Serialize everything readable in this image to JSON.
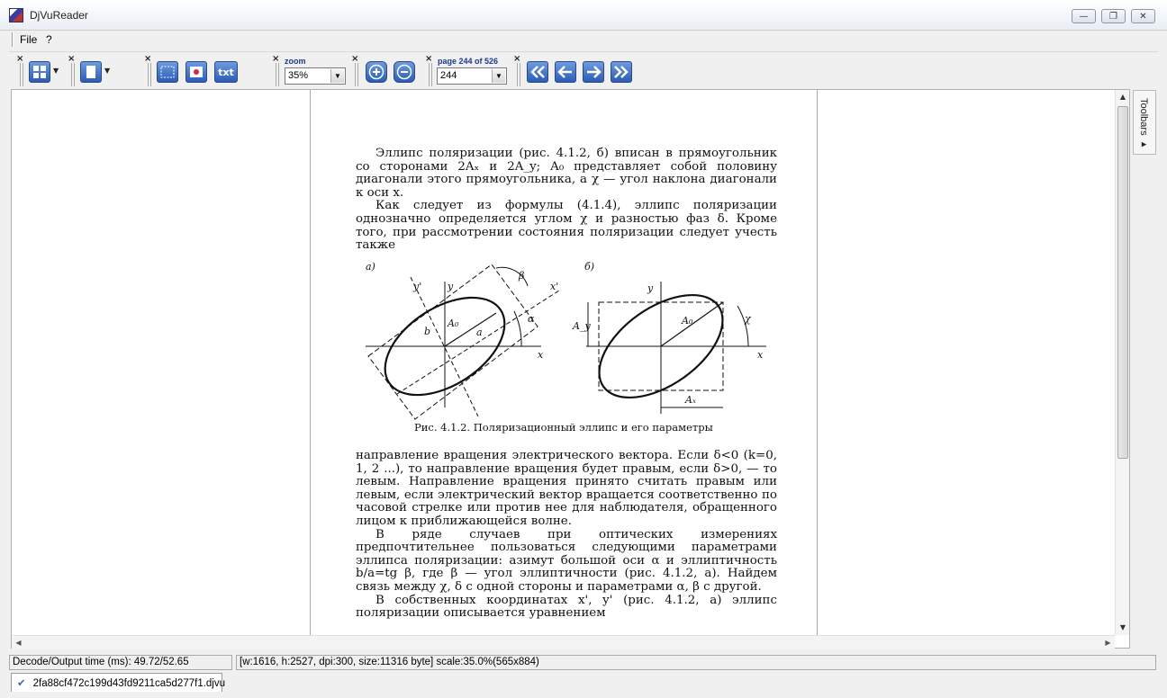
{
  "window": {
    "title": "DjVuReader",
    "minimize": "—",
    "restore": "❐",
    "close": "✕"
  },
  "menu": {
    "items": [
      "File",
      "?"
    ]
  },
  "toolbar": {
    "close_glyph": "×",
    "text_button": "txt",
    "zoom": {
      "caption": "zoom",
      "value": "35%"
    },
    "page": {
      "caption": "page 244 of 526",
      "value": "244"
    }
  },
  "sidebar": {
    "toolbars_label": "Toolbars ▸"
  },
  "document": {
    "paragraph1": "Эллипс поляризации (рис. 4.1.2, б) вписан в прямоугольник со сторонами 2Aₓ и 2A_y; A₀ представляет собой половину диагонали этого прямоугольника, а χ — угол наклона диагонали к оси x.",
    "paragraph2": "Как следует из формулы (4.1.4), эллипс поляризации однозначно определяется углом χ и разностью фаз δ. Кроме того, при рассмотрении состояния поляризации следует учесть также",
    "figure_caption": "Рис. 4.1.2. Поляризационный эллипс и его параметры",
    "figure_labels": {
      "a_panel": "а)",
      "b_panel": "б)",
      "y_prime": "y'",
      "y": "y",
      "x_prime": "x'",
      "x": "x",
      "a0": "A₀",
      "b": "b",
      "a": "a",
      "beta": "β",
      "alpha": "α",
      "chi": "χ",
      "ay": "A_y",
      "ax": "Aₓ"
    },
    "paragraph3": "направление вращения электрического вектора. Если δ<0 (k=0, 1, 2 ...), то направление вращения будет правым, если δ>0, — то левым. Направление вращения принято считать правым или левым, если электрический вектор вращается соответственно по часовой стрелке или против нее для наблюдателя, обращенного лицом к приближающейся волне.",
    "paragraph4": "В ряде случаев при оптических измерениях предпочтительнее пользоваться следующими параметрами эллипса поляризации: азимут большой оси α и эллиптичность b/a=tg β, где β — угол эллиптичности (рис. 4.1.2, а). Найдем связь между χ, δ с одной стороны и параметрами α, β с другой.",
    "paragraph5": "В собственных координатах x', y' (рис. 4.1.2, а) эллипс поляризации описывается уравнением"
  },
  "status": {
    "decode_time": "Decode/Output time (ms): 49.72/52.65",
    "image_info": "[w:1616, h:2527, dpi:300, size:11316 byte] scale:35.0%(565x884)"
  },
  "tabs": [
    {
      "label": "2fa88cf472c199d43fd9211ca5d277f1.djvu"
    }
  ]
}
